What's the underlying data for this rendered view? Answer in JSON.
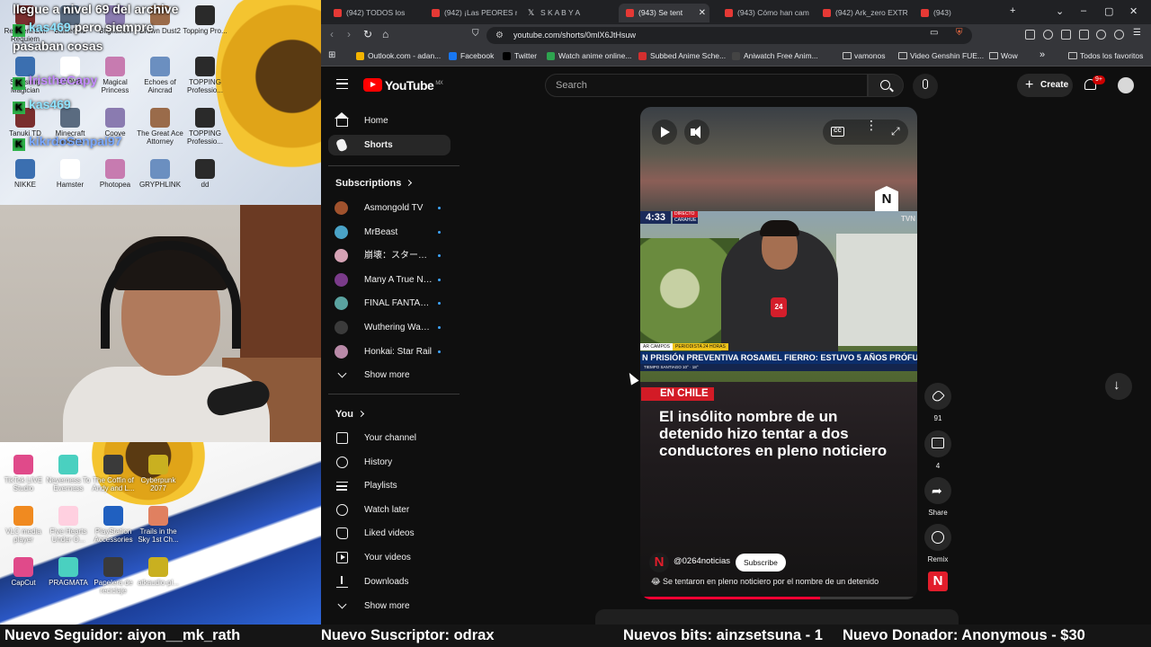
{
  "stream": {
    "chat": [
      {
        "user": "",
        "text": "llegue a nivel 69 del archive",
        "badge": ""
      },
      {
        "user": "kas469",
        "text": "pero siempre",
        "badge": "K"
      },
      {
        "user": "",
        "text": "pasaban cosas",
        "badge": ""
      },
      {
        "user": "IristheCapy",
        "text": "",
        "badge": "K"
      },
      {
        "user": "kas469",
        "text": "",
        "badge": "K"
      },
      {
        "user": "kikrdoSenpai97",
        "text": "",
        "badge": "K"
      }
    ],
    "desktop_top_icons": [
      "Resident Evil Requiem",
      "Battlefield",
      "Blightmon",
      "Brown Dust2",
      "Topping Pro...",
      "Samsung Magician",
      "STOVE",
      "Magical Princess",
      "Echoes of Aincrad",
      "TOPPING Professio...",
      "Tanuki TD",
      "Minecraft Launcher",
      "Coove",
      "The Great Ace Attorney",
      "TOPPING Professio...",
      "NIKKE",
      "Hamster",
      "Photopea",
      "GRYPHLINK",
      "dd"
    ],
    "desktop_bottom_icons": [
      "TikTok LIVE Studio",
      "Neverness To Everness",
      "The Coffin of Andy and L...",
      "Cyberpunk 2077",
      "VLC media player",
      "Five Hearts Under O...",
      "PlayStation Accessories",
      "Trails in the Sky 1st Ch...",
      "CapCut",
      "PRAGMATA",
      "Papelera de reciclaje",
      "atkaudio-pl..."
    ]
  },
  "browser": {
    "tabs": [
      {
        "label": "(942) TODOS los",
        "fav": "yt"
      },
      {
        "label": "(942) ¡Las PEORES re",
        "fav": "yt"
      },
      {
        "label": "S K A B Y A",
        "fav": "x"
      },
      {
        "label": "(943) Se tent",
        "fav": "yt",
        "active": true
      },
      {
        "label": "(943) Cómo han cam",
        "fav": "yt"
      },
      {
        "label": "(942) Ark_zero EXTR",
        "fav": "yt"
      },
      {
        "label": "(943)",
        "fav": "yt"
      }
    ],
    "new_tab": "+",
    "url": "youtube.com/shorts/0mlX6JtHsuw",
    "bookmarks": [
      {
        "label": "Outlook.com - adan...",
        "color": "#f4b400"
      },
      {
        "label": "Facebook",
        "color": "#1877f2"
      },
      {
        "label": "Twitter",
        "color": "#000000"
      },
      {
        "label": "Watch anime online...",
        "color": "#2ea44f"
      },
      {
        "label": "Subbed Anime Sche...",
        "color": "#d32f2f"
      },
      {
        "label": "Aniwatch Free Anim...",
        "color": "#444444"
      },
      {
        "label": "vamonos",
        "color": "folder"
      },
      {
        "label": "Video Genshin FUE...",
        "color": "folder"
      },
      {
        "label": "Wow",
        "color": "folder"
      },
      {
        "label": "Todos los favoritos",
        "color": "folder"
      }
    ]
  },
  "youtube": {
    "logo_text": "YouTube",
    "country": "MX",
    "search_placeholder": "Search",
    "create_label": "Create",
    "notif_count": "9+",
    "nav": [
      {
        "label": "Home",
        "icon": "home-icon"
      },
      {
        "label": "Shorts",
        "icon": "shorts-icon",
        "active": true
      }
    ],
    "subscriptions_title": "Subscriptions",
    "subscriptions": [
      {
        "label": "Asmongold TV",
        "color": "#a0522d"
      },
      {
        "label": "MrBeast",
        "color": "#4aa3c7"
      },
      {
        "label": "崩壊：スターレ...",
        "color": "#d6a3b5"
      },
      {
        "label": "Many A True Nerd",
        "color": "#7a3b8a"
      },
      {
        "label": "FINAL FANTASY ...",
        "color": "#5aa3a0"
      },
      {
        "label": "Wuthering Waves",
        "color": "#3b3b3b"
      },
      {
        "label": "Honkai: Star Rail",
        "color": "#b98aa8"
      }
    ],
    "show_more": "Show more",
    "you_title": "You",
    "you_items": [
      {
        "label": "Your channel",
        "icon": "channel-icon"
      },
      {
        "label": "History",
        "icon": "history-icon"
      },
      {
        "label": "Playlists",
        "icon": "playlists-icon"
      },
      {
        "label": "Watch later",
        "icon": "watch-later-icon"
      },
      {
        "label": "Liked videos",
        "icon": "liked-icon"
      },
      {
        "label": "Your videos",
        "icon": "your-videos-icon"
      },
      {
        "label": "Downloads",
        "icon": "downloads-icon"
      }
    ],
    "show_more_2": "Show more",
    "short": {
      "clock": "4:33",
      "live_top": "DIRECTO",
      "live_place": "CARAHUE",
      "channel_mark": "TVN",
      "reporter_name": "AR CAMPOS",
      "reporter_role": "PERIODISTA 24 HORAS",
      "headline": "N PRISIÓN PREVENTIVA ROSAMEL FIERRO: ESTUVO 5 AÑOS PRÓFUGO",
      "ticker": "TIEMPO   SANTIAGO   10°   ·   18°",
      "mic_label": "24",
      "corner_logo": "N",
      "category": "EN CHILE",
      "title": "El insólito nombre de un detenido hizo tentar a dos conductores en pleno noticiero",
      "channel_avatar": "N",
      "channel": "@0264noticias",
      "subscribe": "Subscribe",
      "description": "😂 Se tentaron en pleno noticiero por el nombre de un detenido",
      "progress": 0.65,
      "cc": "CC"
    },
    "actions": {
      "likes": "91",
      "comments": "4",
      "share": "Share",
      "remix": "Remix",
      "rail_logo": "N"
    }
  },
  "alerts": [
    "Nuevo Seguidor: aiyon__mk_rath",
    "Nuevo Suscriptor: odrax",
    "Nuevos bits: ainzsetsuna - 1",
    "Nuevo Donador: Anonymous - $30"
  ]
}
